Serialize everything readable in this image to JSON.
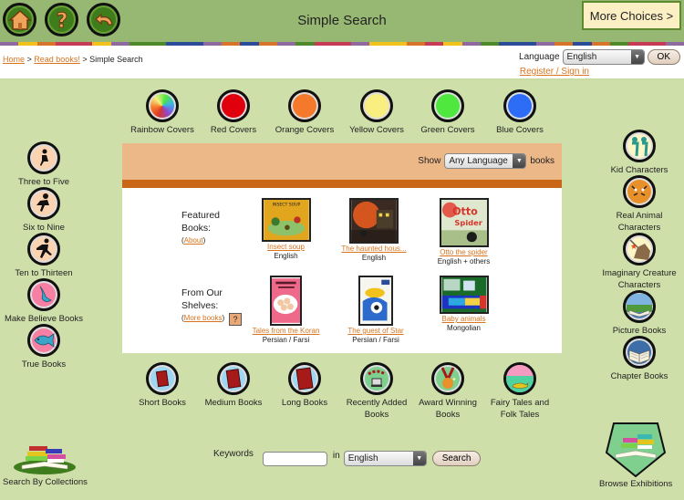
{
  "header": {
    "title": "Simple Search",
    "more_choices": "More Choices >",
    "nav_icons": [
      "home-icon",
      "help-icon",
      "back-icon"
    ]
  },
  "stripe_colors": [
    "#8e6aa0",
    "#f1c21b",
    "#d8732b",
    "#c73a55",
    "#c73a55",
    "#f1c21b",
    "#8e6aa0",
    "#4f8a2a",
    "#4f8a2a",
    "#2c4c9a",
    "#2c4c9a",
    "#8e6aa0",
    "#d8732b",
    "#2c4c9a",
    "#d8732b",
    "#8e6aa0",
    "#4f8a2a",
    "#c73a55",
    "#c73a55",
    "#8e6aa0",
    "#f1c21b",
    "#f1c21b",
    "#d8732b",
    "#c73a55",
    "#f1c21b",
    "#8e6aa0",
    "#4f8a2a",
    "#2c4c9a",
    "#2c4c9a",
    "#8e6aa0",
    "#d8732b",
    "#2c4c9a",
    "#d8732b",
    "#4f8a2a",
    "#c73a55",
    "#c73a55",
    "#8e6aa0"
  ],
  "breadcrumb": {
    "home": "Home",
    "sep": " > ",
    "read_books": "Read books!",
    "current": "Simple Search"
  },
  "language_bar": {
    "label": "Language",
    "selected": "English",
    "ok": "OK",
    "register": "Register / Sign in"
  },
  "color_covers": [
    {
      "label": "Rainbow Covers",
      "color": "rainbow"
    },
    {
      "label": "Red Covers",
      "color": "#e0000d"
    },
    {
      "label": "Orange Covers",
      "color": "#f5792a"
    },
    {
      "label": "Yellow Covers",
      "color": "#f8ef80"
    },
    {
      "label": "Green Covers",
      "color": "#4fe83e"
    },
    {
      "label": "Blue Covers",
      "color": "#2d6df6"
    }
  ],
  "left_sidebar": [
    {
      "label": "Three to Five",
      "icon": "toddler-silhouette-icon"
    },
    {
      "label": "Six to Nine",
      "icon": "child-running-icon"
    },
    {
      "label": "Ten to Thirteen",
      "icon": "teen-running-icon"
    },
    {
      "label": "Make Believe Books",
      "icon": "mermaid-icon"
    },
    {
      "label": "True Books",
      "icon": "fish-icon"
    }
  ],
  "right_sidebar": [
    {
      "label": "Kid Characters",
      "icon": "kids-icon"
    },
    {
      "label": "Real Animal Characters",
      "icon": "tiger-icon"
    },
    {
      "label": "Imaginary Creature Characters",
      "icon": "unicorn-icon"
    },
    {
      "label": "Picture Books",
      "icon": "picture-book-icon"
    },
    {
      "label": "Chapter Books",
      "icon": "chapter-book-icon"
    }
  ],
  "panel": {
    "show_label": "Show",
    "show_selected": "Any Language",
    "books_label": "books",
    "featured": {
      "title_line1": "Featured",
      "title_line2": "Books:",
      "about": "About",
      "books": [
        {
          "title": "Insect soup",
          "language": "English"
        },
        {
          "title": "The haunted hous...",
          "language": "English"
        },
        {
          "title": "Otto the spider",
          "language": "English + others"
        }
      ]
    },
    "shelves": {
      "title_line1": "From Our",
      "title_line2": "Shelves:",
      "more": "More books",
      "help": "?",
      "books": [
        {
          "title": "Tales from the Koran",
          "language": "Persian / Farsi"
        },
        {
          "title": "The guest of Star",
          "language": "Persian / Farsi"
        },
        {
          "title": "Baby animals",
          "language": "Mongolian"
        }
      ]
    }
  },
  "bottom_categories": [
    {
      "label": "Short Books",
      "label2": ""
    },
    {
      "label": "Medium Books",
      "label2": ""
    },
    {
      "label": "Long Books",
      "label2": ""
    },
    {
      "label": "Recently Added",
      "label2": "Books"
    },
    {
      "label": "Award Winning",
      "label2": "Books"
    },
    {
      "label": "Fairy Tales and",
      "label2": "Folk Tales"
    }
  ],
  "footer": {
    "collections": "Search By Collections",
    "exhibitions": "Browse Exhibitions",
    "keywords_label": "Keywords",
    "keywords_value": "",
    "in_label": "in",
    "search_lang": "English",
    "search_button": "Search"
  }
}
